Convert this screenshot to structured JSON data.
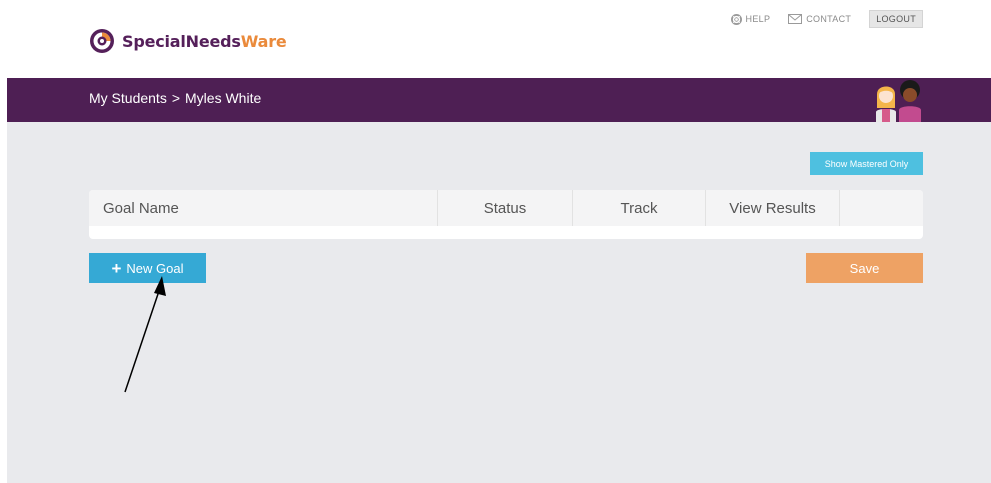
{
  "brand": {
    "name_part1": "SpecialNeeds",
    "name_part2": "Ware",
    "colors": {
      "purple": "#55205a",
      "orange": "#ea8a3b",
      "band": "#4e1f54"
    }
  },
  "top_nav": {
    "help": {
      "label": "HELP",
      "icon": "lifebuoy-icon"
    },
    "contact": {
      "label": "CONTACT",
      "icon": "envelope-icon"
    },
    "logout": {
      "label": "LOGOUT"
    }
  },
  "breadcrumb": {
    "root": "My Students",
    "separator": ">",
    "current": "Myles White"
  },
  "toolbar": {
    "show_mastered_label": "Show Mastered Only"
  },
  "goals_table": {
    "columns": [
      "Goal Name",
      "Status",
      "Track",
      "View Results",
      ""
    ],
    "rows": []
  },
  "actions": {
    "new_goal_label": "New Goal",
    "new_goal_icon": "plus-icon",
    "save_label": "Save"
  },
  "annotation": {
    "type": "arrow",
    "target": "new-goal-button",
    "color": "#000000"
  }
}
